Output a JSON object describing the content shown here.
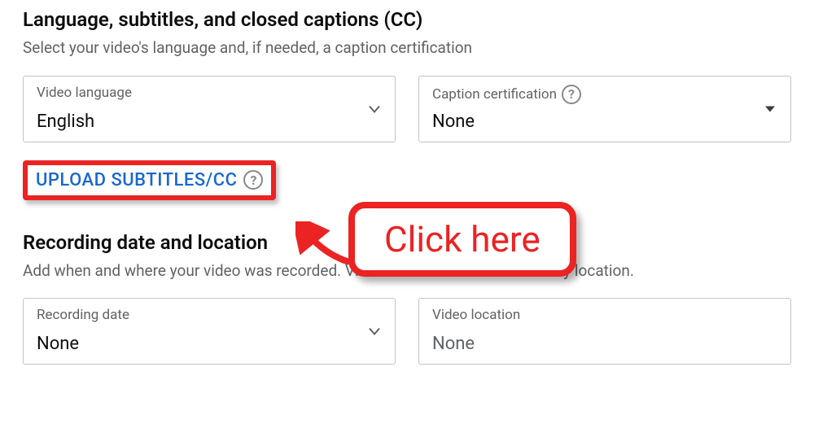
{
  "language_section": {
    "title": "Language, subtitles, and closed captions (CC)",
    "subtitle": "Select your video's language and, if needed, a caption certification",
    "video_language": {
      "label": "Video language",
      "value": "English"
    },
    "caption_certification": {
      "label": "Caption certification",
      "value": "None"
    },
    "upload_label": "UPLOAD SUBTITLES/CC"
  },
  "recording_section": {
    "title": "Recording date and location",
    "subtitle": "Add when and where your video was recorded. Viewers can search for videos by location.",
    "recording_date": {
      "label": "Recording date",
      "value": "None"
    },
    "video_location": {
      "label": "Video location",
      "value": "None"
    }
  },
  "callout": {
    "text": "Click here"
  }
}
